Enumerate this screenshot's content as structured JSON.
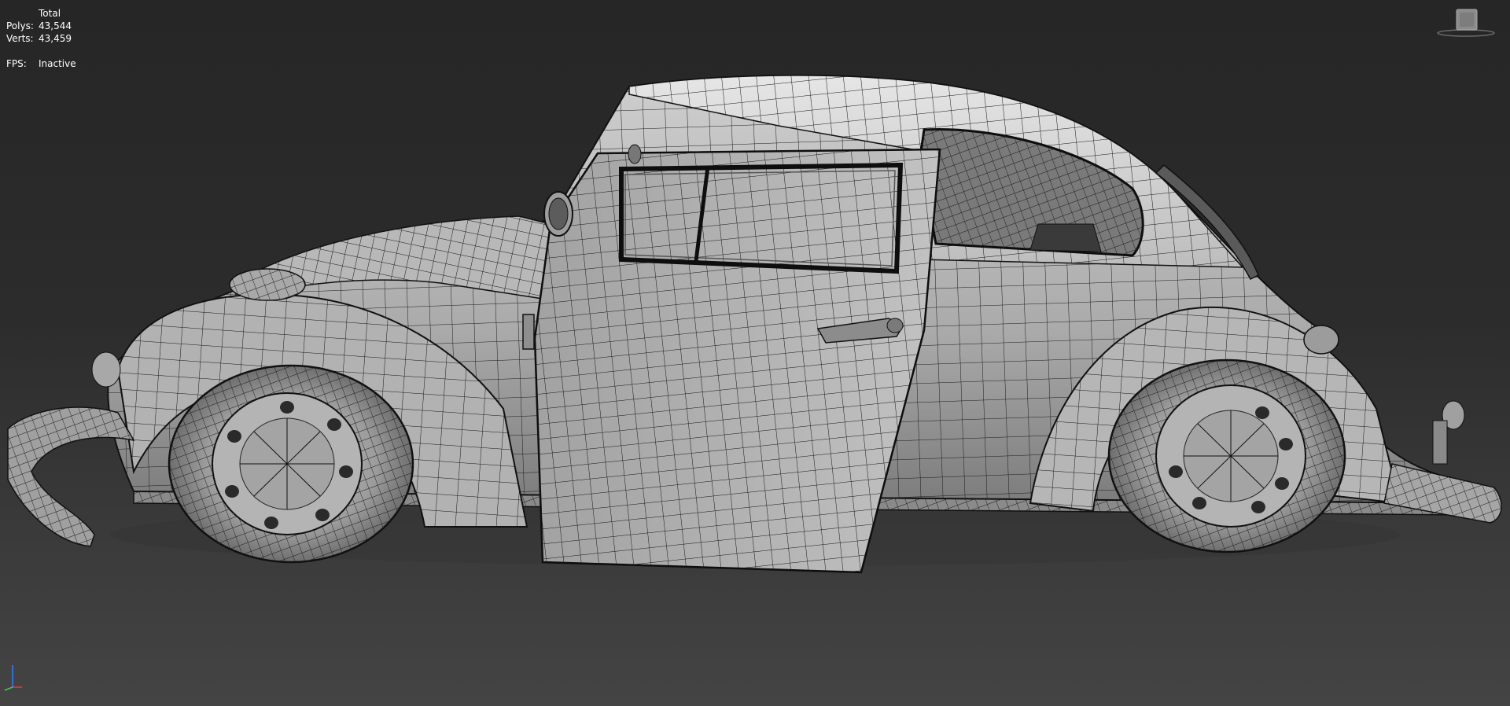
{
  "stats": {
    "header": "Total",
    "polys_label": "Polys:",
    "polys_value": "43,544",
    "verts_label": "Verts:",
    "verts_value": "43,459",
    "fps_label": "FPS:",
    "fps_value": "Inactive"
  },
  "viewcube": {
    "icon": "viewcube-icon"
  },
  "axis_gizmo": {
    "icon": "axis-tripod-icon"
  },
  "colors": {
    "background_top": "#262626",
    "background_bottom": "#444444",
    "mesh_fill": "#9a9a9a",
    "mesh_highlight": "#d2d2d2",
    "wire": "#141414",
    "text": "#ffffff"
  }
}
